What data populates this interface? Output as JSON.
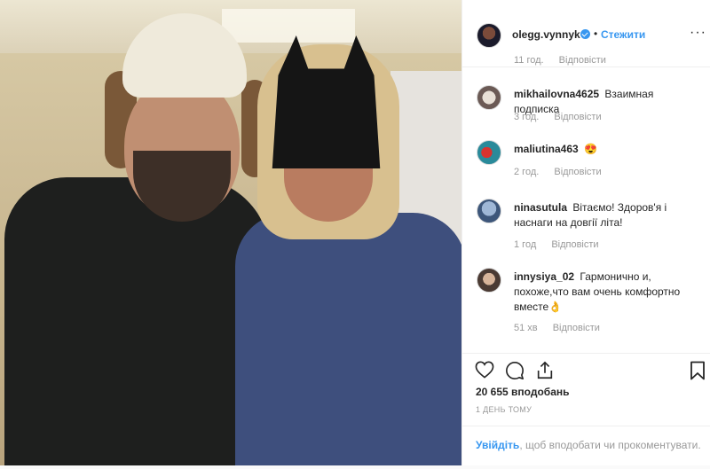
{
  "header": {
    "username": "olegg.vynnyk",
    "separator": "•",
    "follow_label": "Стежити",
    "more_label": "···"
  },
  "comments_partial": {
    "time": "11 год.",
    "reply": "Відповісти"
  },
  "comments": [
    {
      "user": "mikhailovna4625",
      "text": "Взаимная подписка",
      "time": "3 год.",
      "reply": "Відповісти"
    },
    {
      "user": "maliutina463",
      "text": "😍",
      "time": "2 год.",
      "reply": "Відповісти"
    },
    {
      "user": "ninasutula",
      "text": "Вітаємо! Здоров'я і наснаги на довгії літа!",
      "time": "1 год",
      "reply": "Відповісти"
    },
    {
      "user": "innysiya_02",
      "text": "Гармонично и, похоже,что вам очень комфортно вместе👌",
      "time": "51 хв",
      "reply": "Відповісти"
    }
  ],
  "likes": "20 655 вподобань",
  "date": "1 ДЕНЬ ТОМУ",
  "footer": {
    "login_label": "Увійдіть",
    "suffix": ", щоб вподобати чи прокоментувати."
  },
  "icons": {
    "verified": "verified-icon",
    "like": "heart-icon",
    "comment": "comment-icon",
    "share": "share-icon",
    "save": "bookmark-icon",
    "more": "more-icon"
  },
  "colors": {
    "accent": "#3897f0",
    "text": "#262626",
    "muted": "#999999",
    "border": "#efefef"
  }
}
